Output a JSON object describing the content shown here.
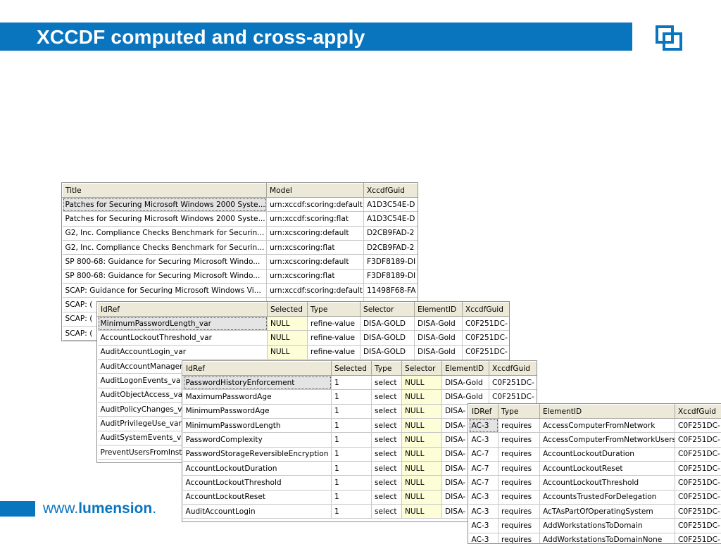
{
  "header": {
    "title": "XCCDF computed and cross-apply",
    "logo_icon": "lumension-logo-icon",
    "bar_color": "#0a75bf"
  },
  "footer": {
    "url_prefix": "www.",
    "url_brand": "lumension",
    "url_suffix": "."
  },
  "grid1": {
    "columns": [
      "Title",
      "Model",
      "XccdfGuid"
    ],
    "rows": [
      [
        "Patches for Securing Microsoft Windows 2000 Syste...",
        "urn:xccdf:scoring:default",
        "A1D3C54E-D"
      ],
      [
        "Patches for Securing Microsoft Windows 2000 Syste...",
        "urn:xccdf:scoring:flat",
        "A1D3C54E-D"
      ],
      [
        "G2, Inc. Compliance Checks Benchmark for Securin...",
        "urn:xcscoring:default",
        "D2CB9FAD-2"
      ],
      [
        "G2, Inc. Compliance Checks Benchmark for Securin...",
        "urn:xcscoring:flat",
        "D2CB9FAD-2"
      ],
      [
        "SP 800-68: Guidance for Securing Microsoft Windo...",
        "urn:xcscoring:default",
        "F3DF8189-DI"
      ],
      [
        "SP 800-68: Guidance for Securing Microsoft Windo...",
        "urn:xcscoring:flat",
        "F3DF8189-DI"
      ],
      [
        "SCAP: Guidance for Securing Microsoft Windows Vi...",
        "urn:xccdf:scoring:default",
        "11498F68-FA"
      ],
      [
        "SCAP: (",
        "",
        ""
      ],
      [
        "SCAP: (",
        "",
        ""
      ],
      [
        "SCAP: (",
        "",
        ""
      ]
    ]
  },
  "grid2": {
    "columns": [
      "IdRef",
      "Selected",
      "Type",
      "Selector",
      "ElementID",
      "XccdfGuid"
    ],
    "rows": [
      [
        "MinimumPasswordLength_var",
        "NULL",
        "refine-value",
        "DISA-GOLD",
        "DISA-Gold",
        "C0F251DC-"
      ],
      [
        "AccountLockoutThreshold_var",
        "NULL",
        "refine-value",
        "DISA-GOLD",
        "DISA-Gold",
        "C0F251DC-"
      ],
      [
        "AuditAccountLogin_var",
        "NULL",
        "refine-value",
        "DISA-GOLD",
        "DISA-Gold",
        "C0F251DC-"
      ],
      [
        "AuditAccountManager",
        "",
        "",
        "",
        "",
        ""
      ],
      [
        "AuditLogonEvents_va",
        "",
        "",
        "",
        "",
        ""
      ],
      [
        "AuditObjectAccess_va",
        "",
        "",
        "",
        "",
        ""
      ],
      [
        "AuditPolicyChanges_v",
        "",
        "",
        "",
        "",
        ""
      ],
      [
        "AuditPrivilegeUse_var",
        "",
        "",
        "",
        "",
        ""
      ],
      [
        "AuditSystemEvents_va",
        "",
        "",
        "",
        "",
        ""
      ],
      [
        "PreventUsersFromInsta",
        "",
        "",
        "",
        "",
        ""
      ]
    ]
  },
  "grid3": {
    "columns": [
      "IdRef",
      "Selected",
      "Type",
      "Selector",
      "ElementID",
      "XccdfGuid"
    ],
    "rows": [
      [
        "PasswordHistoryEnforcement",
        "1",
        "select",
        "NULL",
        "DISA-Gold",
        "C0F251DC-"
      ],
      [
        "MaximumPasswordAge",
        "1",
        "select",
        "NULL",
        "DISA-Gold",
        "C0F251DC-"
      ],
      [
        "MinimumPasswordAge",
        "1",
        "select",
        "NULL",
        "DISA-",
        ""
      ],
      [
        "MinimumPasswordLength",
        "1",
        "select",
        "NULL",
        "DISA-",
        ""
      ],
      [
        "PasswordComplexity",
        "1",
        "select",
        "NULL",
        "DISA-",
        ""
      ],
      [
        "PasswordStorageReversibleEncryption",
        "1",
        "select",
        "NULL",
        "DISA-",
        ""
      ],
      [
        "AccountLockoutDuration",
        "1",
        "select",
        "NULL",
        "DISA-",
        ""
      ],
      [
        "AccountLockoutThreshold",
        "1",
        "select",
        "NULL",
        "DISA-",
        ""
      ],
      [
        "AccountLockoutReset",
        "1",
        "select",
        "NULL",
        "DISA-",
        ""
      ],
      [
        "AuditAccountLogin",
        "1",
        "select",
        "NULL",
        "DISA-",
        ""
      ]
    ]
  },
  "grid4": {
    "columns": [
      "IDRef",
      "Type",
      "ElementID",
      "XccdfGuid"
    ],
    "rows": [
      [
        "AC-3",
        "requires",
        "AccessComputerFromNetwork",
        "C0F251DC-"
      ],
      [
        "AC-3",
        "requires",
        "AccessComputerFromNetworkUsers",
        "C0F251DC-"
      ],
      [
        "AC-7",
        "requires",
        "AccountLockoutDuration",
        "C0F251DC-"
      ],
      [
        "AC-7",
        "requires",
        "AccountLockoutReset",
        "C0F251DC-"
      ],
      [
        "AC-7",
        "requires",
        "AccountLockoutThreshold",
        "C0F251DC-"
      ],
      [
        "AC-3",
        "requires",
        "AccountsTrustedForDelegation",
        "C0F251DC-"
      ],
      [
        "AC-3",
        "requires",
        "AcTAsPartOfOperatingSystem",
        "C0F251DC-"
      ],
      [
        "AC-3",
        "requires",
        "AddWorkstationsToDomain",
        "C0F251DC-"
      ],
      [
        "AC-3",
        "requires",
        "AddWorkstationsToDomainNone",
        "C0F251DC-"
      ]
    ]
  }
}
